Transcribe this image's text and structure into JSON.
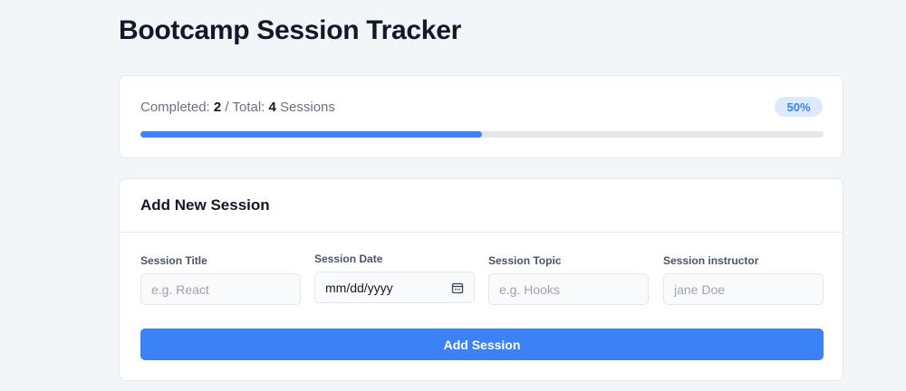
{
  "page": {
    "title": "Bootcamp Session Tracker"
  },
  "progress": {
    "completed_label": "Completed:",
    "completed": "2",
    "separator": "/",
    "total_label": "Total:",
    "total": "4",
    "unit": "Sessions",
    "percent_label": "50%",
    "percent": 50
  },
  "form": {
    "title": "Add New Session",
    "fields": {
      "title": {
        "label": "Session Title",
        "placeholder": "e.g. React"
      },
      "date": {
        "label": "Session Date",
        "placeholder": "mm/dd/yyyy"
      },
      "topic": {
        "label": "Session Topic",
        "placeholder": "e.g. Hooks"
      },
      "instructor": {
        "label": "Session instructor",
        "placeholder": "jane Doe"
      }
    },
    "submit_label": "Add Session"
  },
  "icons": {
    "date_picker": "calendar-icon"
  },
  "colors": {
    "accent": "#3b82f6",
    "badge_bg": "#dbeafe",
    "track": "#e5e7eb",
    "background": "#f3f6f9"
  }
}
